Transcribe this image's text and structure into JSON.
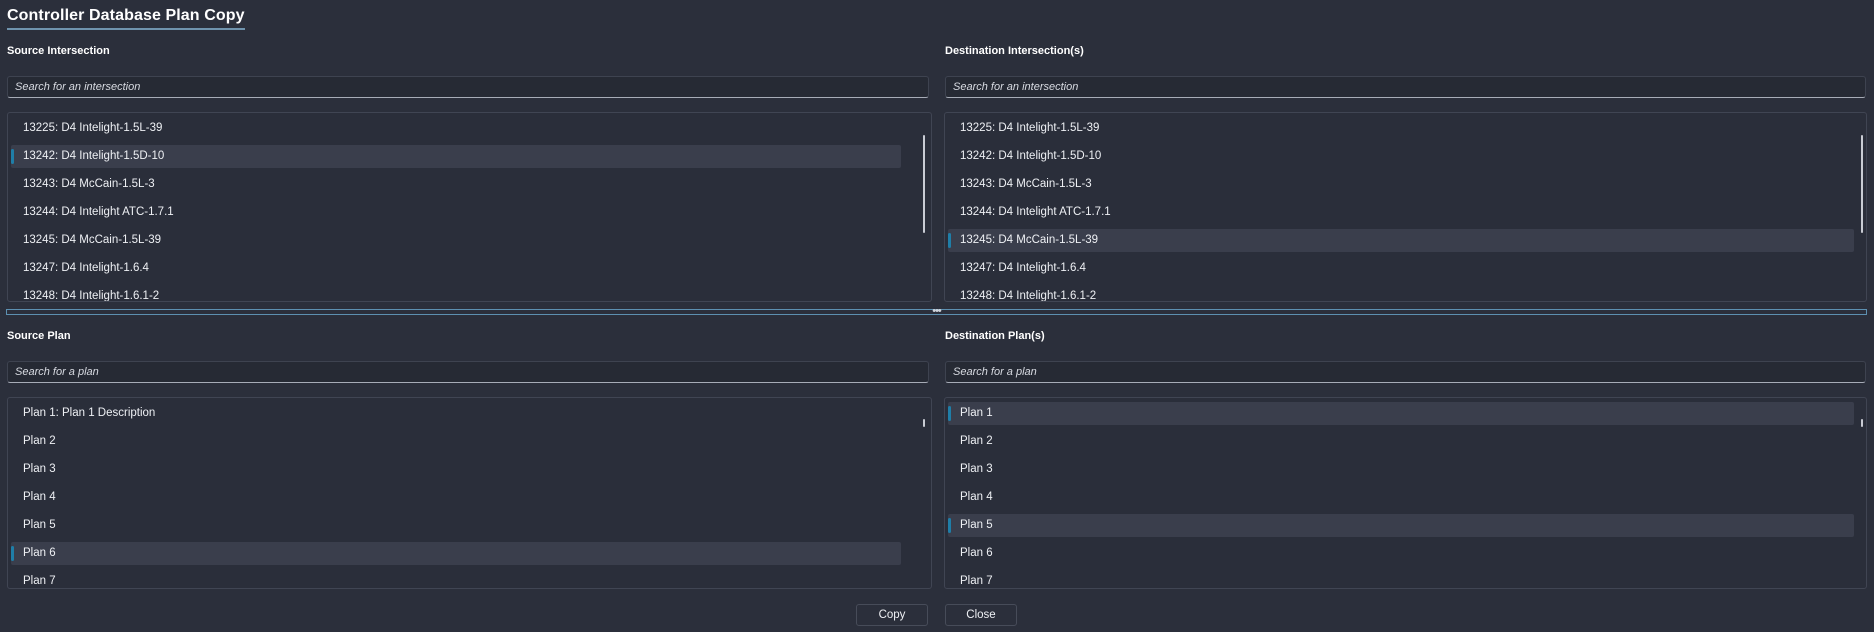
{
  "window": {
    "title": "Controller Database Plan Copy"
  },
  "source_intersection": {
    "label": "Source Intersection",
    "search_placeholder": "Search for an intersection",
    "items": [
      {
        "label": "13225: D4 Intelight-1.5L-39",
        "selected": false
      },
      {
        "label": "13242: D4 Intelight-1.5D-10",
        "selected": true
      },
      {
        "label": "13243: D4 McCain-1.5L-3",
        "selected": false
      },
      {
        "label": "13244: D4 Intelight ATC-1.7.1",
        "selected": false
      },
      {
        "label": "13245: D4 McCain-1.5L-39",
        "selected": false
      },
      {
        "label": "13247: D4 Intelight-1.6.4",
        "selected": false
      },
      {
        "label": "13248: D4 Intelight-1.6.1-2",
        "selected": false
      }
    ]
  },
  "destination_intersections": {
    "label": "Destination Intersection(s)",
    "search_placeholder": "Search for an intersection",
    "items": [
      {
        "label": "13225: D4 Intelight-1.5L-39",
        "selected": false
      },
      {
        "label": "13242: D4 Intelight-1.5D-10",
        "selected": false
      },
      {
        "label": "13243: D4 McCain-1.5L-3",
        "selected": false
      },
      {
        "label": "13244: D4 Intelight ATC-1.7.1",
        "selected": false
      },
      {
        "label": "13245: D4 McCain-1.5L-39",
        "selected": true
      },
      {
        "label": "13247: D4 Intelight-1.6.4",
        "selected": false
      },
      {
        "label": "13248: D4 Intelight-1.6.1-2",
        "selected": false
      }
    ]
  },
  "splitter": {
    "icon": "grip-dots-icon"
  },
  "source_plan": {
    "label": "Source Plan",
    "search_placeholder": "Search for a plan",
    "items": [
      {
        "label": "Plan 1: Plan 1 Description",
        "selected": false
      },
      {
        "label": "Plan 2",
        "selected": false
      },
      {
        "label": "Plan 3",
        "selected": false
      },
      {
        "label": "Plan 4",
        "selected": false
      },
      {
        "label": "Plan 5",
        "selected": false
      },
      {
        "label": "Plan 6",
        "selected": true
      },
      {
        "label": "Plan 7",
        "selected": false
      }
    ]
  },
  "destination_plans": {
    "label": "Destination Plan(s)",
    "search_placeholder": "Search for a plan",
    "items": [
      {
        "label": "Plan 1",
        "selected": true
      },
      {
        "label": "Plan 2",
        "selected": false
      },
      {
        "label": "Plan 3",
        "selected": false
      },
      {
        "label": "Plan 4",
        "selected": false
      },
      {
        "label": "Plan 5",
        "selected": true
      },
      {
        "label": "Plan 6",
        "selected": false
      },
      {
        "label": "Plan 7",
        "selected": false
      }
    ]
  },
  "buttons": {
    "copy_label": "Copy",
    "close_label": "Close"
  },
  "colors": {
    "background": "#2b2f3b",
    "selected_row": "#3a3e4c",
    "selection_accent": "#1f7ea8",
    "splitter_border": "#5d90b1"
  }
}
